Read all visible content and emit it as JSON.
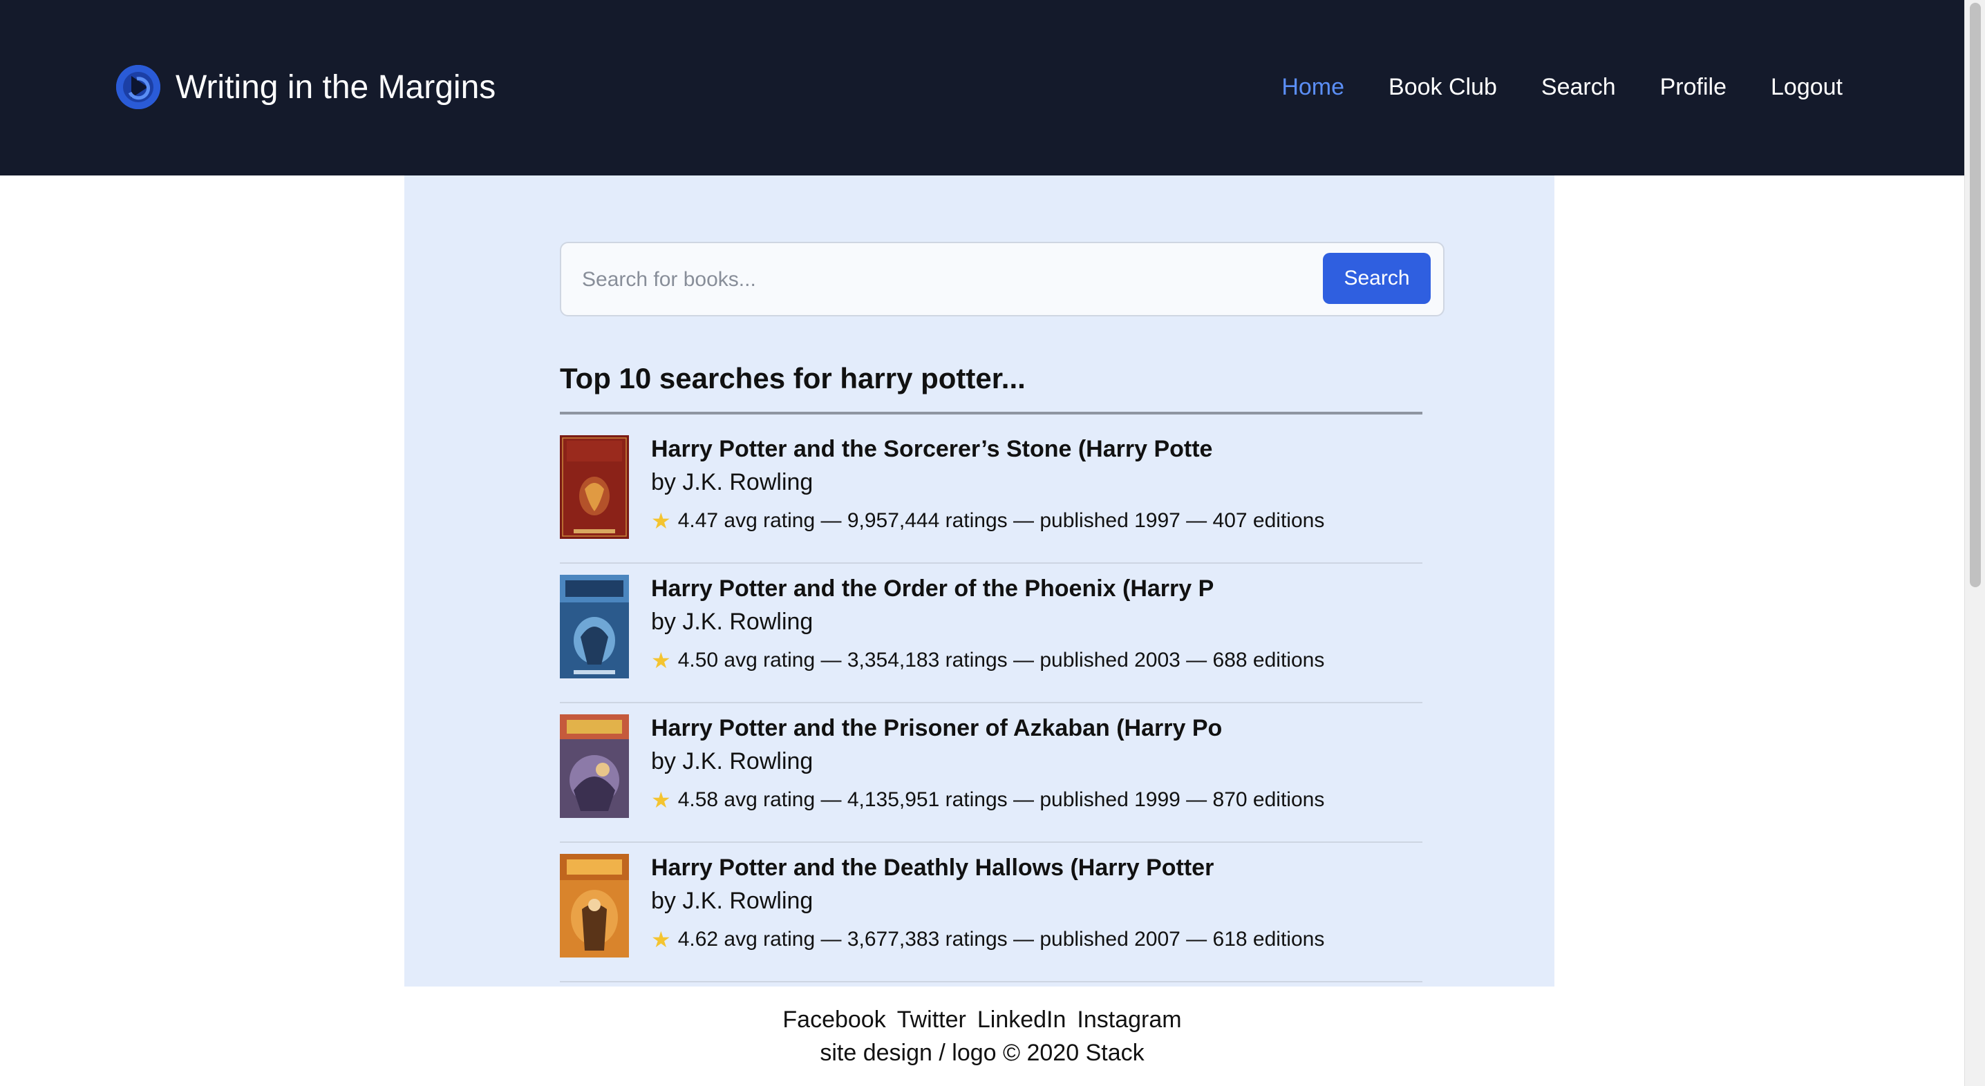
{
  "header": {
    "brand_title": "Writing in the Margins",
    "logo_icon": "logo-icon",
    "nav": [
      {
        "label": "Home",
        "active": true
      },
      {
        "label": "Book Club",
        "active": false
      },
      {
        "label": "Search",
        "active": false
      },
      {
        "label": "Profile",
        "active": false
      },
      {
        "label": "Logout",
        "active": false
      }
    ]
  },
  "search": {
    "placeholder": "Search for books...",
    "value": "",
    "button_label": "Search"
  },
  "results": {
    "heading": "Top 10 searches for harry potter...",
    "items": [
      {
        "title": "Harry Potter and the Sorcerer’s Stone (Harry Potte",
        "author": "by J.K. Rowling",
        "meta": "4.47 avg rating — 9,957,444 ratings — published 1997 — 407 editions"
      },
      {
        "title": "Harry Potter and the Order of the Phoenix (Harry P",
        "author": "by J.K. Rowling",
        "meta": "4.50 avg rating — 3,354,183 ratings — published 2003 — 688 editions"
      },
      {
        "title": "Harry Potter and the Prisoner of Azkaban (Harry Po",
        "author": "by J.K. Rowling",
        "meta": "4.58 avg rating — 4,135,951 ratings — published 1999 — 870 editions"
      },
      {
        "title": "Harry Potter and the Deathly Hallows (Harry Potter",
        "author": "by J.K. Rowling",
        "meta": "4.62 avg rating — 3,677,383 ratings — published 2007 — 618 editions"
      }
    ]
  },
  "footer": {
    "links": [
      "Facebook",
      "Twitter",
      "LinkedIn",
      "Instagram"
    ],
    "copyright": "site design / logo © 2020 Stack"
  },
  "colors": {
    "header_bg": "#141a2b",
    "accent": "#2f5fe0",
    "nav_active": "#5b8ef5",
    "panel_bg": "#e3ecfb",
    "star": "#f4c430"
  }
}
